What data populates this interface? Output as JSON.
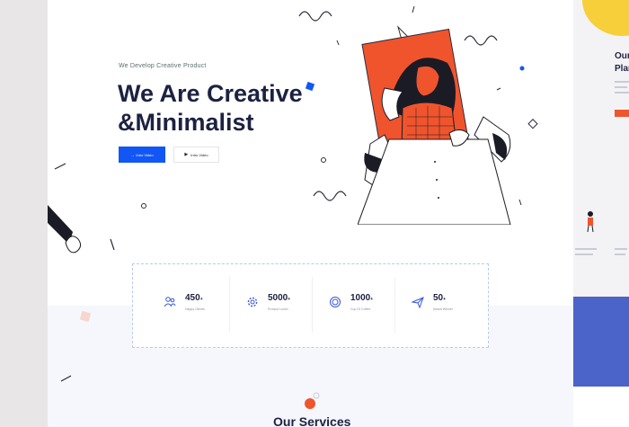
{
  "hero": {
    "eyebrow": "We Develop Creative Product",
    "headline": "We Are Creative\n&Minimalist",
    "primary_button": "Intro Video",
    "secondary_button": "Intro Video"
  },
  "stats": [
    {
      "value": "450",
      "suffix": "+",
      "label": "Happy Clients",
      "icon": "users-icon"
    },
    {
      "value": "5000",
      "suffix": "+",
      "label": "Product Lunch",
      "icon": "gear-icon"
    },
    {
      "value": "1000",
      "suffix": "+",
      "label": "Cup Of Coffee",
      "icon": "coffee-icon"
    },
    {
      "value": "50",
      "suffix": "+",
      "label": "Award Winner",
      "icon": "paper-plane-icon"
    }
  ],
  "services": {
    "title": "Our Services"
  },
  "side_card": {
    "title_line1": "Our",
    "title_line2": "Plan"
  },
  "colors": {
    "accent_blue": "#1257f5",
    "accent_orange": "#f0542d",
    "navy": "#1d2141"
  }
}
